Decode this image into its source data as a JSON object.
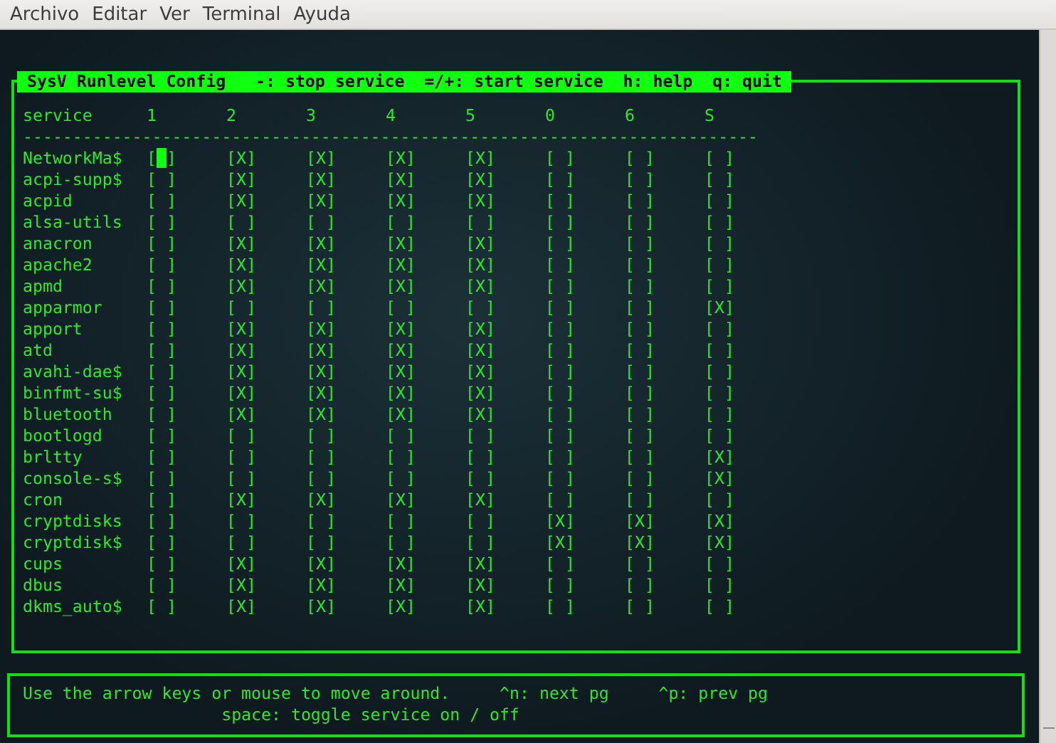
{
  "menu": [
    "Archivo",
    "Editar",
    "Ver",
    "Terminal",
    "Ayuda"
  ],
  "title": " SysV Runlevel Config   -: stop service  =/+: start service  h: help  q: quit ",
  "columns": [
    "service",
    "1",
    "2",
    "3",
    "4",
    "5",
    "0",
    "6",
    "S"
  ],
  "rule": "--------------------------------------------------------------------------",
  "rows": [
    {
      "service": "NetworkMa$",
      "cells": [
        {
          "t": "[ ]",
          "selected": true
        },
        {
          "t": "[X]",
          "selected": false
        },
        {
          "t": "[X]",
          "selected": false
        },
        {
          "t": "[X]",
          "selected": false
        },
        {
          "t": "[X]",
          "selected": false
        },
        {
          "t": "[ ]",
          "selected": false
        },
        {
          "t": "[ ]",
          "selected": false
        },
        {
          "t": "[ ]",
          "selected": false
        }
      ]
    },
    {
      "service": "acpi-supp$",
      "cells": [
        {
          "t": "[ ]",
          "selected": false
        },
        {
          "t": "[X]",
          "selected": false
        },
        {
          "t": "[X]",
          "selected": false
        },
        {
          "t": "[X]",
          "selected": false
        },
        {
          "t": "[X]",
          "selected": false
        },
        {
          "t": "[ ]",
          "selected": false
        },
        {
          "t": "[ ]",
          "selected": false
        },
        {
          "t": "[ ]",
          "selected": false
        }
      ]
    },
    {
      "service": "acpid",
      "cells": [
        {
          "t": "[ ]",
          "selected": false
        },
        {
          "t": "[X]",
          "selected": false
        },
        {
          "t": "[X]",
          "selected": false
        },
        {
          "t": "[X]",
          "selected": false
        },
        {
          "t": "[X]",
          "selected": false
        },
        {
          "t": "[ ]",
          "selected": false
        },
        {
          "t": "[ ]",
          "selected": false
        },
        {
          "t": "[ ]",
          "selected": false
        }
      ]
    },
    {
      "service": "alsa-utils",
      "cells": [
        {
          "t": "[ ]",
          "selected": false
        },
        {
          "t": "[ ]",
          "selected": false
        },
        {
          "t": "[ ]",
          "selected": false
        },
        {
          "t": "[ ]",
          "selected": false
        },
        {
          "t": "[ ]",
          "selected": false
        },
        {
          "t": "[ ]",
          "selected": false
        },
        {
          "t": "[ ]",
          "selected": false
        },
        {
          "t": "[ ]",
          "selected": false
        }
      ]
    },
    {
      "service": "anacron",
      "cells": [
        {
          "t": "[ ]",
          "selected": false
        },
        {
          "t": "[X]",
          "selected": false
        },
        {
          "t": "[X]",
          "selected": false
        },
        {
          "t": "[X]",
          "selected": false
        },
        {
          "t": "[X]",
          "selected": false
        },
        {
          "t": "[ ]",
          "selected": false
        },
        {
          "t": "[ ]",
          "selected": false
        },
        {
          "t": "[ ]",
          "selected": false
        }
      ]
    },
    {
      "service": "apache2",
      "cells": [
        {
          "t": "[ ]",
          "selected": false
        },
        {
          "t": "[X]",
          "selected": false
        },
        {
          "t": "[X]",
          "selected": false
        },
        {
          "t": "[X]",
          "selected": false
        },
        {
          "t": "[X]",
          "selected": false
        },
        {
          "t": "[ ]",
          "selected": false
        },
        {
          "t": "[ ]",
          "selected": false
        },
        {
          "t": "[ ]",
          "selected": false
        }
      ]
    },
    {
      "service": "apmd",
      "cells": [
        {
          "t": "[ ]",
          "selected": false
        },
        {
          "t": "[X]",
          "selected": false
        },
        {
          "t": "[X]",
          "selected": false
        },
        {
          "t": "[X]",
          "selected": false
        },
        {
          "t": "[X]",
          "selected": false
        },
        {
          "t": "[ ]",
          "selected": false
        },
        {
          "t": "[ ]",
          "selected": false
        },
        {
          "t": "[ ]",
          "selected": false
        }
      ]
    },
    {
      "service": "apparmor",
      "cells": [
        {
          "t": "[ ]",
          "selected": false
        },
        {
          "t": "[ ]",
          "selected": false
        },
        {
          "t": "[ ]",
          "selected": false
        },
        {
          "t": "[ ]",
          "selected": false
        },
        {
          "t": "[ ]",
          "selected": false
        },
        {
          "t": "[ ]",
          "selected": false
        },
        {
          "t": "[ ]",
          "selected": false
        },
        {
          "t": "[X]",
          "selected": false
        }
      ]
    },
    {
      "service": "apport",
      "cells": [
        {
          "t": "[ ]",
          "selected": false
        },
        {
          "t": "[X]",
          "selected": false
        },
        {
          "t": "[X]",
          "selected": false
        },
        {
          "t": "[X]",
          "selected": false
        },
        {
          "t": "[X]",
          "selected": false
        },
        {
          "t": "[ ]",
          "selected": false
        },
        {
          "t": "[ ]",
          "selected": false
        },
        {
          "t": "[ ]",
          "selected": false
        }
      ]
    },
    {
      "service": "atd",
      "cells": [
        {
          "t": "[ ]",
          "selected": false
        },
        {
          "t": "[X]",
          "selected": false
        },
        {
          "t": "[X]",
          "selected": false
        },
        {
          "t": "[X]",
          "selected": false
        },
        {
          "t": "[X]",
          "selected": false
        },
        {
          "t": "[ ]",
          "selected": false
        },
        {
          "t": "[ ]",
          "selected": false
        },
        {
          "t": "[ ]",
          "selected": false
        }
      ]
    },
    {
      "service": "avahi-dae$",
      "cells": [
        {
          "t": "[ ]",
          "selected": false
        },
        {
          "t": "[X]",
          "selected": false
        },
        {
          "t": "[X]",
          "selected": false
        },
        {
          "t": "[X]",
          "selected": false
        },
        {
          "t": "[X]",
          "selected": false
        },
        {
          "t": "[ ]",
          "selected": false
        },
        {
          "t": "[ ]",
          "selected": false
        },
        {
          "t": "[ ]",
          "selected": false
        }
      ]
    },
    {
      "service": "binfmt-su$",
      "cells": [
        {
          "t": "[ ]",
          "selected": false
        },
        {
          "t": "[X]",
          "selected": false
        },
        {
          "t": "[X]",
          "selected": false
        },
        {
          "t": "[X]",
          "selected": false
        },
        {
          "t": "[X]",
          "selected": false
        },
        {
          "t": "[ ]",
          "selected": false
        },
        {
          "t": "[ ]",
          "selected": false
        },
        {
          "t": "[ ]",
          "selected": false
        }
      ]
    },
    {
      "service": "bluetooth",
      "cells": [
        {
          "t": "[ ]",
          "selected": false
        },
        {
          "t": "[X]",
          "selected": false
        },
        {
          "t": "[X]",
          "selected": false
        },
        {
          "t": "[X]",
          "selected": false
        },
        {
          "t": "[X]",
          "selected": false
        },
        {
          "t": "[ ]",
          "selected": false
        },
        {
          "t": "[ ]",
          "selected": false
        },
        {
          "t": "[ ]",
          "selected": false
        }
      ]
    },
    {
      "service": "bootlogd",
      "cells": [
        {
          "t": "[ ]",
          "selected": false
        },
        {
          "t": "[ ]",
          "selected": false
        },
        {
          "t": "[ ]",
          "selected": false
        },
        {
          "t": "[ ]",
          "selected": false
        },
        {
          "t": "[ ]",
          "selected": false
        },
        {
          "t": "[ ]",
          "selected": false
        },
        {
          "t": "[ ]",
          "selected": false
        },
        {
          "t": "[ ]",
          "selected": false
        }
      ]
    },
    {
      "service": "brltty",
      "cells": [
        {
          "t": "[ ]",
          "selected": false
        },
        {
          "t": "[ ]",
          "selected": false
        },
        {
          "t": "[ ]",
          "selected": false
        },
        {
          "t": "[ ]",
          "selected": false
        },
        {
          "t": "[ ]",
          "selected": false
        },
        {
          "t": "[ ]",
          "selected": false
        },
        {
          "t": "[ ]",
          "selected": false
        },
        {
          "t": "[X]",
          "selected": false
        }
      ]
    },
    {
      "service": "console-s$",
      "cells": [
        {
          "t": "[ ]",
          "selected": false
        },
        {
          "t": "[ ]",
          "selected": false
        },
        {
          "t": "[ ]",
          "selected": false
        },
        {
          "t": "[ ]",
          "selected": false
        },
        {
          "t": "[ ]",
          "selected": false
        },
        {
          "t": "[ ]",
          "selected": false
        },
        {
          "t": "[ ]",
          "selected": false
        },
        {
          "t": "[X]",
          "selected": false
        }
      ]
    },
    {
      "service": "cron",
      "cells": [
        {
          "t": "[ ]",
          "selected": false
        },
        {
          "t": "[X]",
          "selected": false
        },
        {
          "t": "[X]",
          "selected": false
        },
        {
          "t": "[X]",
          "selected": false
        },
        {
          "t": "[X]",
          "selected": false
        },
        {
          "t": "[ ]",
          "selected": false
        },
        {
          "t": "[ ]",
          "selected": false
        },
        {
          "t": "[ ]",
          "selected": false
        }
      ]
    },
    {
      "service": "cryptdisks",
      "cells": [
        {
          "t": "[ ]",
          "selected": false
        },
        {
          "t": "[ ]",
          "selected": false
        },
        {
          "t": "[ ]",
          "selected": false
        },
        {
          "t": "[ ]",
          "selected": false
        },
        {
          "t": "[ ]",
          "selected": false
        },
        {
          "t": "[X]",
          "selected": false
        },
        {
          "t": "[X]",
          "selected": false
        },
        {
          "t": "[X]",
          "selected": false
        }
      ]
    },
    {
      "service": "cryptdisk$",
      "cells": [
        {
          "t": "[ ]",
          "selected": false
        },
        {
          "t": "[ ]",
          "selected": false
        },
        {
          "t": "[ ]",
          "selected": false
        },
        {
          "t": "[ ]",
          "selected": false
        },
        {
          "t": "[ ]",
          "selected": false
        },
        {
          "t": "[X]",
          "selected": false
        },
        {
          "t": "[X]",
          "selected": false
        },
        {
          "t": "[X]",
          "selected": false
        }
      ]
    },
    {
      "service": "cups",
      "cells": [
        {
          "t": "[ ]",
          "selected": false
        },
        {
          "t": "[X]",
          "selected": false
        },
        {
          "t": "[X]",
          "selected": false
        },
        {
          "t": "[X]",
          "selected": false
        },
        {
          "t": "[X]",
          "selected": false
        },
        {
          "t": "[ ]",
          "selected": false
        },
        {
          "t": "[ ]",
          "selected": false
        },
        {
          "t": "[ ]",
          "selected": false
        }
      ]
    },
    {
      "service": "dbus",
      "cells": [
        {
          "t": "[ ]",
          "selected": false
        },
        {
          "t": "[X]",
          "selected": false
        },
        {
          "t": "[X]",
          "selected": false
        },
        {
          "t": "[X]",
          "selected": false
        },
        {
          "t": "[X]",
          "selected": false
        },
        {
          "t": "[ ]",
          "selected": false
        },
        {
          "t": "[ ]",
          "selected": false
        },
        {
          "t": "[ ]",
          "selected": false
        }
      ]
    },
    {
      "service": "dkms_auto$",
      "cells": [
        {
          "t": "[ ]",
          "selected": false
        },
        {
          "t": "[X]",
          "selected": false
        },
        {
          "t": "[X]",
          "selected": false
        },
        {
          "t": "[X]",
          "selected": false
        },
        {
          "t": "[X]",
          "selected": false
        },
        {
          "t": "[ ]",
          "selected": false
        },
        {
          "t": "[ ]",
          "selected": false
        },
        {
          "t": "[ ]",
          "selected": false
        }
      ]
    }
  ],
  "help": [
    "Use the arrow keys or mouse to move around.     ^n: next pg     ^p: prev pg",
    "                    space: toggle service on / off"
  ]
}
